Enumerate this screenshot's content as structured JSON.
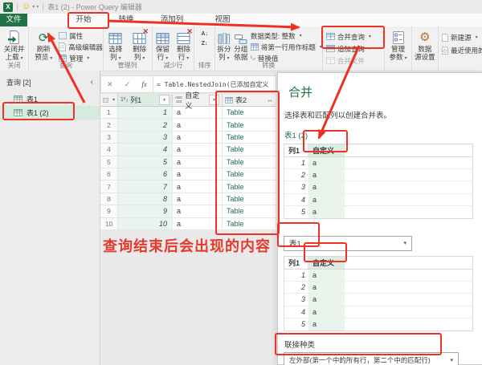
{
  "colors": {
    "accent_green": "#217346",
    "annotation_red": "#ee3124",
    "cell_highlight": "#e9f3ed",
    "header_highlight": "#dcece3",
    "selected_query_bg": "#d5ebdd",
    "table_link_green": "#217346"
  },
  "title_bar": {
    "app_title": "表1 (2) - Power Query 编辑器"
  },
  "tabs": {
    "file": "文件",
    "home": "开始",
    "transform": "转换",
    "add_column": "添加列",
    "view": "视图"
  },
  "ribbon": {
    "close_group": {
      "label": "关闭",
      "close_and_load": "关闭并\n上载"
    },
    "query_group": {
      "label": "查询",
      "refresh_preview": "刷新\n预览",
      "properties": "属性",
      "advanced_editor": "高级编辑器",
      "manage": "管理"
    },
    "manage_columns_group": {
      "label": "管理列",
      "choose_columns": "选择\n列",
      "remove_columns": "删除\n列"
    },
    "reduce_rows_group": {
      "label": "减少行",
      "keep_rows": "保留\n行",
      "remove_rows": "删除\n行"
    },
    "sort_group": {
      "label": "排序"
    },
    "transform_group": {
      "label": "转换",
      "split_column": "拆分\n列",
      "group_by": "分组\n依据",
      "data_type": "数据类型: 整数",
      "use_first_row": "将第一行用作标题",
      "replace_values": "替换值"
    },
    "combine_group": {
      "merge_queries": "合并查询",
      "append_queries": "追加查询",
      "combine_files": "合并文件"
    },
    "parameters_group": {
      "manage_parameters": "管理\n参数"
    },
    "data_sources_group": {
      "data_source_settings": "数据\n源设置"
    },
    "new_query_group": {
      "new_source": "新建源",
      "recent_sources": "最近使用的源"
    }
  },
  "query_pane": {
    "header": "查询 [2]",
    "items": [
      {
        "name": "表1"
      },
      {
        "name": "表1 (2)"
      }
    ]
  },
  "formula_bar": {
    "formula": "= Table.NestedJoin(已添加自定义"
  },
  "main_table": {
    "headers": {
      "col1_type": "1²₃",
      "col1": "列1",
      "custom_type": "ABC\n123",
      "custom": "自定义",
      "table2": "表2"
    },
    "rows": [
      {
        "num": "1",
        "col1": "1",
        "custom": "a",
        "table2": "Table"
      },
      {
        "num": "2",
        "col1": "2",
        "custom": "a",
        "table2": "Table"
      },
      {
        "num": "3",
        "col1": "3",
        "custom": "a",
        "table2": "Table"
      },
      {
        "num": "4",
        "col1": "4",
        "custom": "a",
        "table2": "Table"
      },
      {
        "num": "5",
        "col1": "5",
        "custom": "a",
        "table2": "Table"
      },
      {
        "num": "6",
        "col1": "6",
        "custom": "a",
        "table2": "Table"
      },
      {
        "num": "7",
        "col1": "7",
        "custom": "a",
        "table2": "Table"
      },
      {
        "num": "8",
        "col1": "8",
        "custom": "a",
        "table2": "Table"
      },
      {
        "num": "9",
        "col1": "9",
        "custom": "a",
        "table2": "Table"
      },
      {
        "num": "10",
        "col1": "10",
        "custom": "a",
        "table2": "Table"
      }
    ]
  },
  "annotation": {
    "caption": "查询结束后会出现的内容"
  },
  "merge_dialog": {
    "title": "合并",
    "subtitle": "选择表和匹配列以创建合并表。",
    "top_table_label": "表1 (2)",
    "top_table": {
      "headers": [
        "列1",
        "自定义"
      ],
      "rows": [
        {
          "col1": "1",
          "custom": "a"
        },
        {
          "col1": "2",
          "custom": "a"
        },
        {
          "col1": "3",
          "custom": "a"
        },
        {
          "col1": "4",
          "custom": "a"
        },
        {
          "col1": "5",
          "custom": "a"
        }
      ]
    },
    "table_selector_value": "表1",
    "bottom_table": {
      "headers": [
        "列1",
        "自定义"
      ],
      "rows": [
        {
          "col1": "1",
          "custom": "a"
        },
        {
          "col1": "2",
          "custom": "a"
        },
        {
          "col1": "3",
          "custom": "a"
        },
        {
          "col1": "4",
          "custom": "a"
        },
        {
          "col1": "5",
          "custom": "a"
        }
      ]
    },
    "join_kind_label": "联接种类",
    "join_kind_value": "左外部(第一个中的所有行，第二个中的匹配行)"
  },
  "icons": {
    "excel": "X",
    "smiley": "☺",
    "caret": "▾",
    "dropdown": "▾",
    "collapse_pane": "‹",
    "cancel": "✕",
    "check": "✓",
    "fx": "fx",
    "refresh": "⟳",
    "gear": "⚙",
    "expand_column": "↔",
    "sort_asc": "A↓",
    "sort_desc": "Z↓",
    "replace_values_glyph": "¹,₂"
  }
}
